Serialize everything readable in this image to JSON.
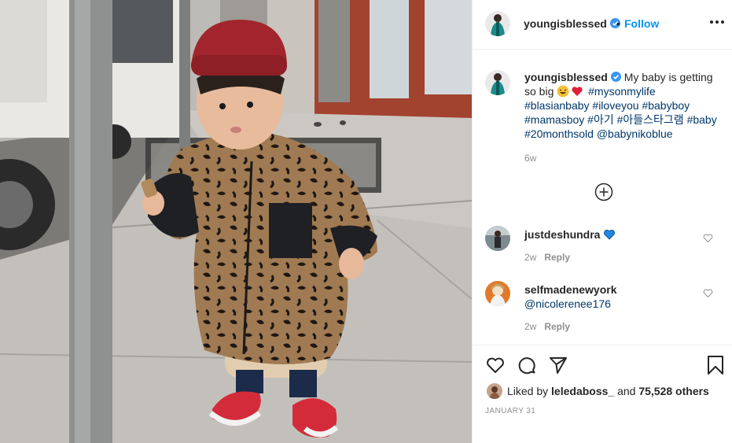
{
  "post": {
    "username": "youngisblessed",
    "verified": true,
    "follow_label": "Follow",
    "separator": "•"
  },
  "caption": {
    "username": "youngisblessed",
    "text": "My baby is getting so big",
    "tags": [
      "#mysonmylife",
      "#blasianbaby",
      "#iloveyou",
      "#babyboy",
      "#mamasboy",
      "#아기",
      "#아들스타그램",
      "#baby",
      "#20monthsold",
      "@babynikoblue"
    ],
    "age": "6w"
  },
  "comments": [
    {
      "username": "justdeshundra",
      "text": "",
      "age": "2w",
      "reply_label": "Reply"
    },
    {
      "username": "selfmadenewyork",
      "text": "@nicolerenee176",
      "age": "2w",
      "reply_label": "Reply"
    }
  ],
  "likes": {
    "prefix": "Liked by",
    "user": "leledaboss_",
    "middle": "and",
    "count": "75,528 others"
  },
  "date": "JANUARY 31",
  "icons": {
    "more": "more-options-icon",
    "load_more": "add-circle-icon",
    "like": "heart-icon",
    "comment": "comment-icon",
    "share": "share-icon",
    "save": "bookmark-icon"
  },
  "colors": {
    "link": "#0095f6",
    "tag": "#00376b",
    "muted": "#8e8e8e",
    "heart_red": "#ed4956",
    "blue_heart": "#1e88e5"
  }
}
